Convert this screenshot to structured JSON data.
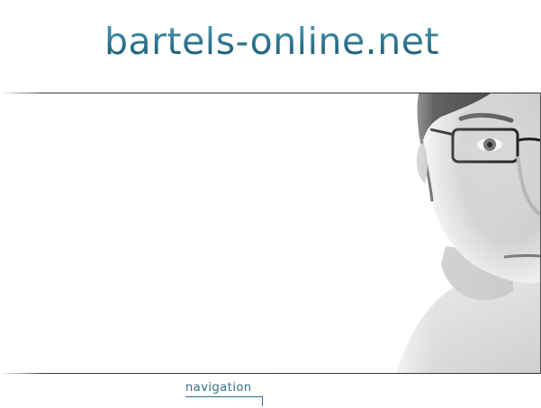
{
  "header": {
    "site_title": "bartels-online.net"
  },
  "hero": {
    "image": "portrait-photo"
  },
  "footer": {
    "navigation_label": "navigation"
  }
}
